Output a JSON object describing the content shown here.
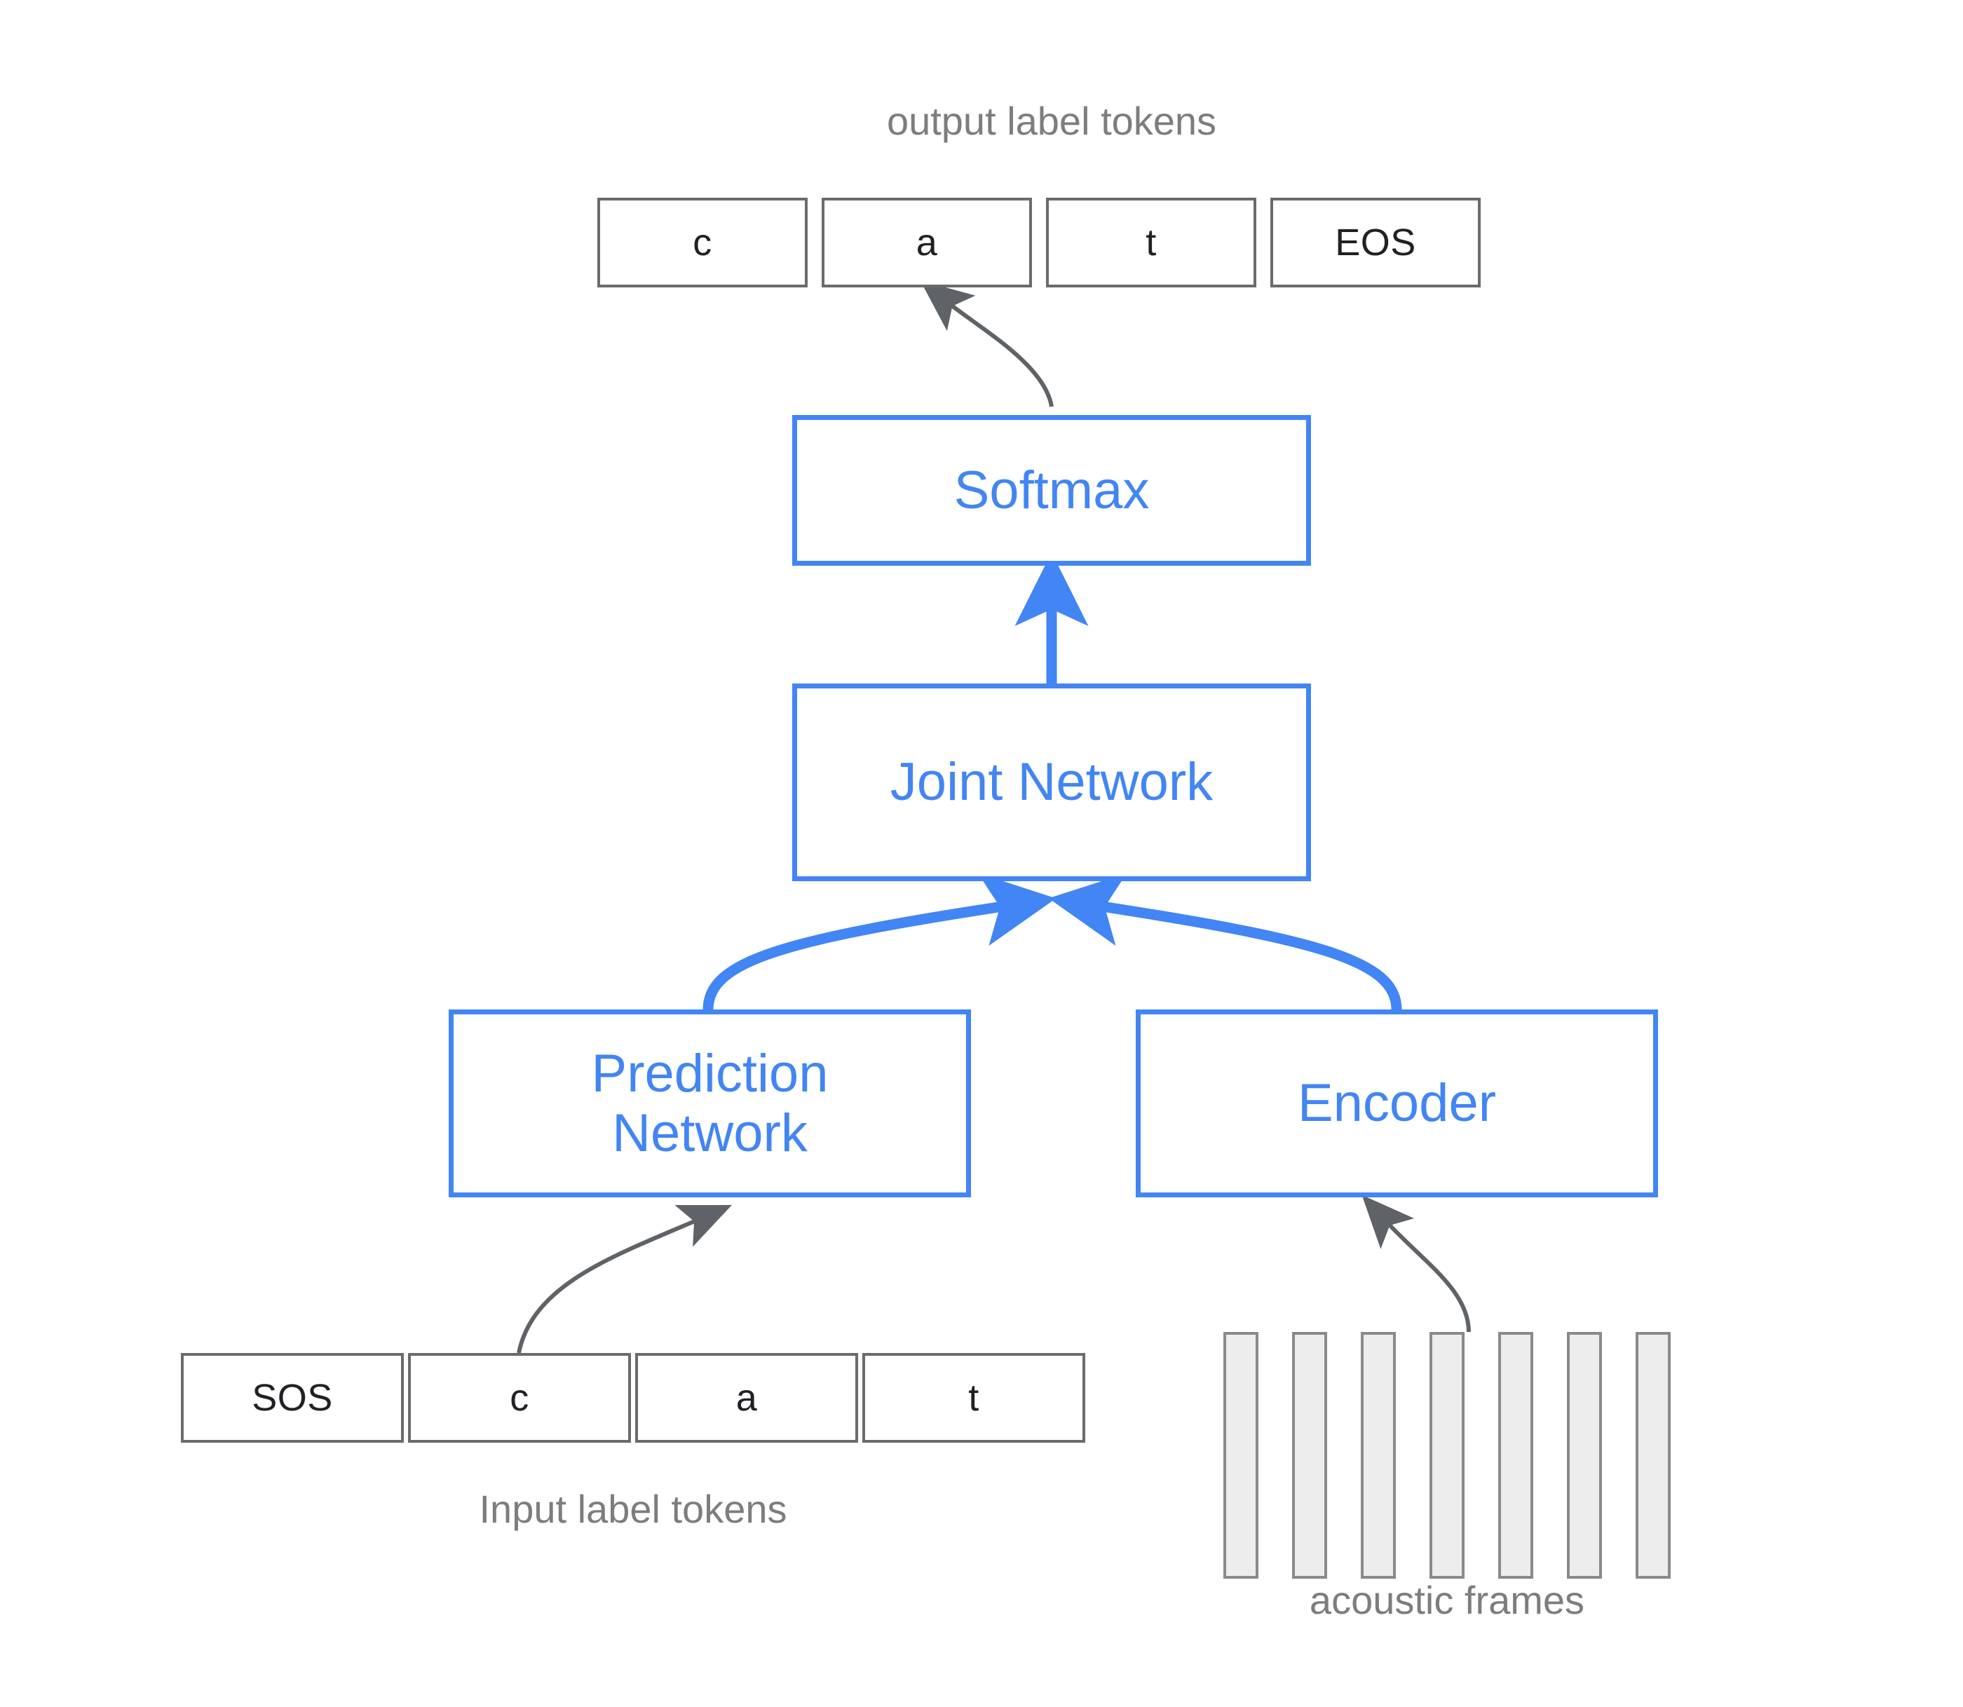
{
  "diagram": {
    "title_caption": "output label tokens",
    "input_caption": "Input label tokens",
    "acoustic_caption": "acoustic frames",
    "colors": {
      "accent_blue": "#4285f4",
      "token_border_gray": "#6b6b6b",
      "caption_gray": "#7d7d7d",
      "frame_fill": "#ededed",
      "frame_border": "#8a8a8a",
      "arrow_gray": "#5f6368",
      "background": "#ffffff"
    },
    "output_tokens": [
      {
        "label": "c"
      },
      {
        "label": "a"
      },
      {
        "label": "t"
      },
      {
        "label": "EOS"
      }
    ],
    "input_tokens": [
      {
        "label": "SOS"
      },
      {
        "label": "c"
      },
      {
        "label": "a"
      },
      {
        "label": "t"
      }
    ],
    "modules": {
      "softmax": "Softmax",
      "joint_network": "Joint Network",
      "prediction_network_line1": "Prediction",
      "prediction_network_line2": "Network",
      "encoder": "Encoder"
    },
    "acoustic_frames": {
      "count": 7,
      "highlighted_index": 3
    }
  }
}
